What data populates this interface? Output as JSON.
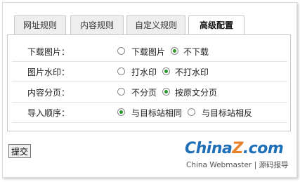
{
  "tabs": [
    {
      "label": "网址规则",
      "active": false
    },
    {
      "label": "内容规则",
      "active": false
    },
    {
      "label": "自定义规则",
      "active": false
    },
    {
      "label": "高级配置",
      "active": true
    }
  ],
  "settings": [
    {
      "label": "下载图片：",
      "options": [
        {
          "text": "下载图片",
          "checked": false
        },
        {
          "text": "不下载",
          "checked": true
        }
      ]
    },
    {
      "label": "图片水印：",
      "options": [
        {
          "text": "打水印",
          "checked": false
        },
        {
          "text": "不打水印",
          "checked": true
        }
      ]
    },
    {
      "label": "内容分页：",
      "options": [
        {
          "text": "不分页",
          "checked": false
        },
        {
          "text": "按原文分页",
          "checked": true
        }
      ]
    },
    {
      "label": "导入顺序：",
      "options": [
        {
          "text": "与目标站相同",
          "checked": true
        },
        {
          "text": "与目标站相反",
          "checked": false
        }
      ]
    }
  ],
  "submit_label": "提交",
  "watermark": {
    "brand_part1": "China",
    "brand_z": "Z",
    "brand_part2": ".com",
    "tagline": "China Webmaster | 源码报导"
  },
  "colors": {
    "radio_checked": "#2a9a2a",
    "brand_blue": "#1f6fb8",
    "brand_orange": "#e8812a"
  }
}
